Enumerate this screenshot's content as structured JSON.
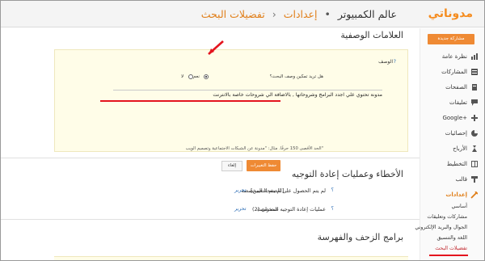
{
  "header": {
    "brand": "مدوناتي",
    "blog_name": "عالم الكمبيوتر",
    "crumb_settings": "إعدادات",
    "crumb_search": "تفضيلات البحث",
    "separator": "›",
    "dot": "•"
  },
  "sidebar": {
    "new_post": "مشاركة جديدة",
    "items": [
      {
        "label": "نظرة عامة",
        "icon": "overview-icon"
      },
      {
        "label": "المشاركات",
        "icon": "posts-icon"
      },
      {
        "label": "الصفحات",
        "icon": "pages-icon"
      },
      {
        "label": "تعليقات",
        "icon": "comments-icon"
      },
      {
        "label": "Google+",
        "icon": "google-plus-icon"
      },
      {
        "label": "إحصائيات",
        "icon": "stats-icon"
      },
      {
        "label": "الأرباح",
        "icon": "earnings-icon"
      },
      {
        "label": "التخطيط",
        "icon": "layout-icon"
      },
      {
        "label": "قالب",
        "icon": "template-icon"
      },
      {
        "label": "إعدادات",
        "icon": "settings-icon"
      }
    ],
    "sub_items": [
      "أساسي",
      "مشاركات وتعليقات",
      "الجوال والبريد الإلكتروني",
      "اللغة والتنسيق",
      "تفضيلات البحث"
    ]
  },
  "meta_tags": {
    "title": "العلامات الوصفية",
    "description_label": "الوصف",
    "question": "هل تريد تمكين وصف البحث؟",
    "yes": "نعم",
    "no": "لا",
    "description_value": "مدونة تحتوي علي اجدد البرامج وشروحاتها , بالاضافة الي شروحات خاصة بالانترنت",
    "help": "الحد الأقصى 150 حرفًا. مثال: \"مدونة عن الشبكات الاجتماعية وتصميم الويب\"",
    "save": "حفظ التغييرات",
    "cancel": "إلغاء"
  },
  "errors": {
    "title": "الأخطاء وعمليات إعادة التوجيه",
    "row1_label": "لم يتم الحصول على الصفحة المخصصة",
    "row1_value": "[لم يتم التعيين]",
    "row2_label": "عمليات إعادة التوجيه المخصصة",
    "row2_value": "عنصران (2)",
    "edit": "تحرير",
    "help_mark": "؟"
  },
  "crawlers": {
    "title": "برامج الزحف والفهرسة"
  },
  "colors": {
    "accent": "#ef8a34",
    "brand": "#f58c1f",
    "highlight_red": "#e4151f",
    "link": "#2a6cb5"
  }
}
